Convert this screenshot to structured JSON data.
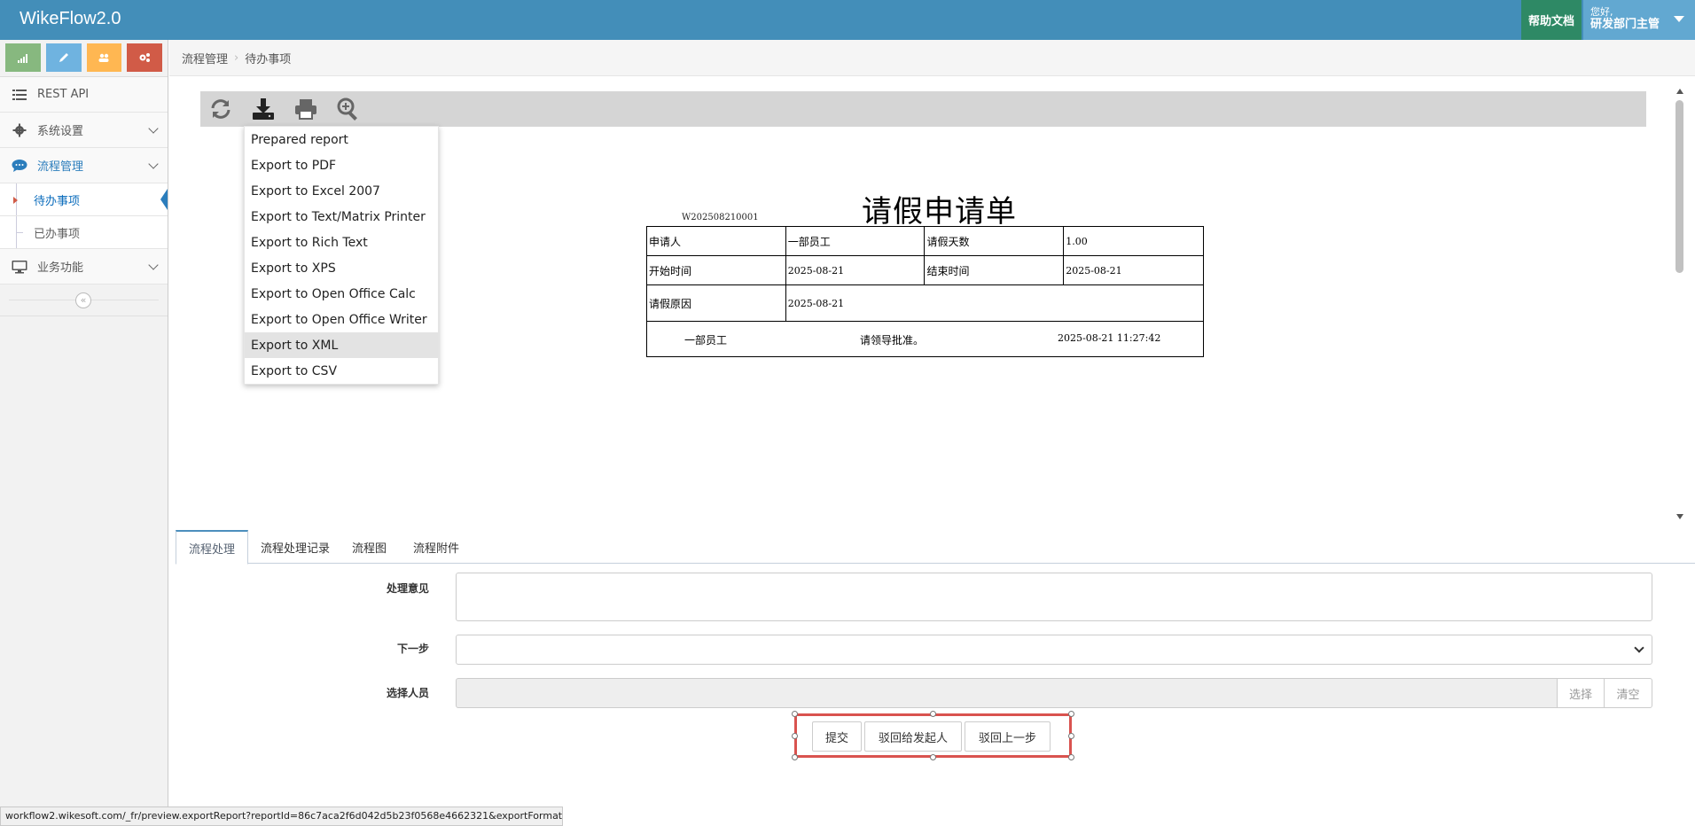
{
  "app": {
    "title": "WikeFlow2.0"
  },
  "header": {
    "help_label": "帮助文档",
    "greeting": "您好,",
    "user_name": "研发部门主管"
  },
  "sidebar": {
    "items": [
      {
        "label": "REST API",
        "icon": "list-icon"
      },
      {
        "label": "系统设置",
        "icon": "gear-icon"
      },
      {
        "label": "流程管理",
        "icon": "chat-icon",
        "expanded": true,
        "children": [
          {
            "label": "待办事项",
            "active": true
          },
          {
            "label": "已办事项"
          }
        ]
      },
      {
        "label": "业务功能",
        "icon": "desktop-icon"
      }
    ],
    "shortcut_colors": [
      "#87b87f",
      "#6fb3e0",
      "#ffb752",
      "#d15b47"
    ]
  },
  "breadcrumb": [
    "流程管理",
    "待办事项"
  ],
  "export_menu": {
    "items": [
      "Prepared report",
      "Export to PDF",
      "Export to Excel 2007",
      "Export to Text/Matrix Printer",
      "Export to Rich Text",
      "Export to XPS",
      "Export to Open Office Calc",
      "Export to Open Office Writer",
      "Export to XML",
      "Export to CSV"
    ],
    "hovered": "Export to XML"
  },
  "report": {
    "title": "请假申请单",
    "number": "W202508210001",
    "rows": {
      "applicant_label": "申请人",
      "applicant": "一部员工",
      "days_label": "请假天数",
      "days": "1.00",
      "start_label": "开始时间",
      "start": "2025-08-21",
      "end_label": "结束时间",
      "end": "2025-08-21",
      "reason_label": "请假原因",
      "reason": "2025-08-21"
    },
    "sign": {
      "person": "一部员工",
      "note": "请领导批准。",
      "time": "2025-08-21 11:27:42"
    }
  },
  "tabs": [
    "流程处理",
    "流程处理记录",
    "流程图",
    "流程附件"
  ],
  "form": {
    "opinion_label": "处理意见",
    "opinion_value": "",
    "next_step_label": "下一步",
    "next_step_value": "",
    "people_label": "选择人员",
    "select_btn": "选择",
    "clear_btn": "清空"
  },
  "actions": {
    "submit": "提交",
    "reject_to_initiator": "驳回给发起人",
    "reject_previous": "驳回上一步"
  },
  "status_bar": "workflow2.wikesoft.com/_fr/preview.exportReport?reportId=86c7aca2f6d042d5b23f0568e4662321&exportFormat=x..."
}
